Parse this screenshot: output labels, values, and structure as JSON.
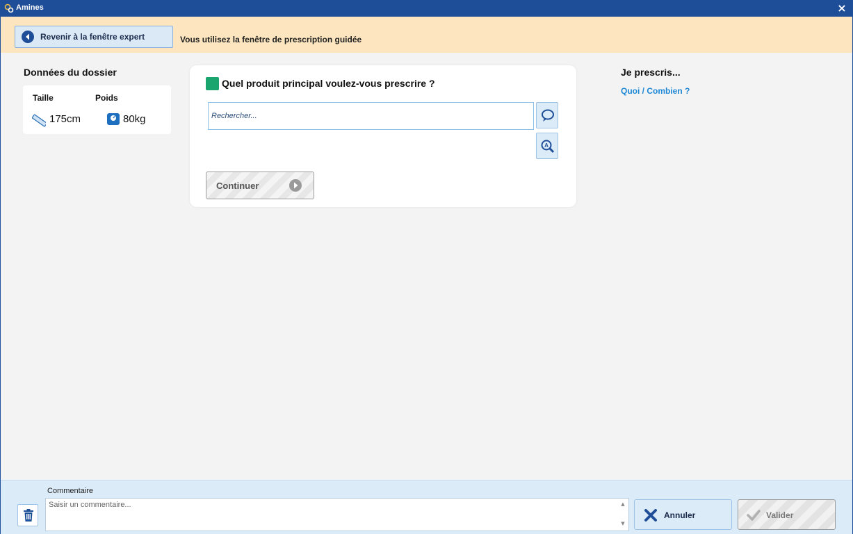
{
  "window": {
    "title": "Amines",
    "close_label": "×"
  },
  "banner": {
    "back_button_label": "Revenir à la fenêtre expert",
    "info_text": "Vous utilisez la fenêtre de prescription guidée"
  },
  "dossier": {
    "title": "Données du dossier",
    "height_header": "Taille",
    "height_value": "175cm",
    "weight_header": "Poids",
    "weight_value": "80kg"
  },
  "question": {
    "text": "Quel produit principal voulez-vous prescrire ?",
    "search_placeholder": "Rechercher...",
    "search_value": "",
    "continue_label": "Continuer"
  },
  "right_panel": {
    "title": "Je prescris...",
    "link": "Quoi / Combien ?"
  },
  "footer": {
    "comment_label": "Commentaire",
    "comment_placeholder": "Saisir un commentaire...",
    "cancel_label": "Annuler",
    "validate_label": "Valider"
  },
  "colors": {
    "titlebar": "#1f4e98",
    "banner": "#fde6bf",
    "accent_blue": "#1e88d6",
    "question_marker": "#1aa56f"
  }
}
